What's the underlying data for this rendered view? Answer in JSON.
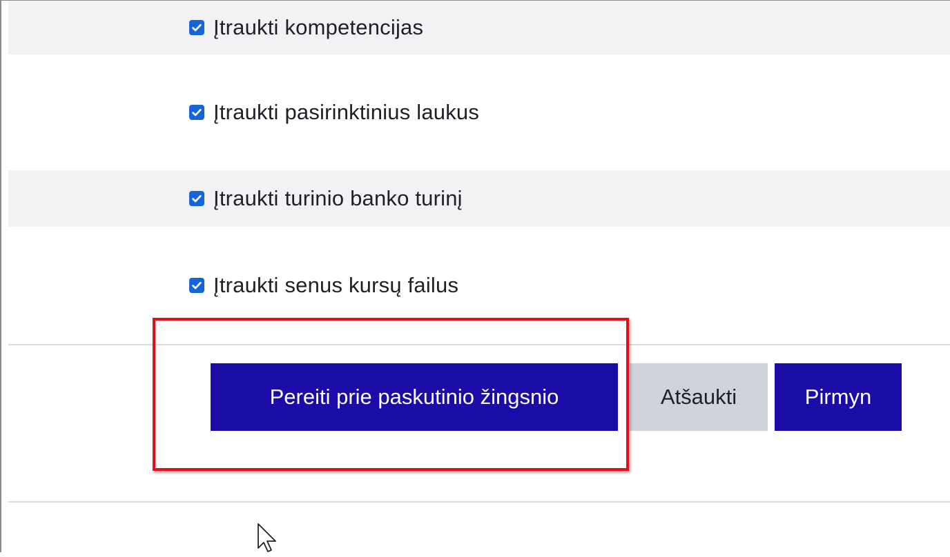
{
  "options": [
    {
      "label": "Įtraukti kompetencijas",
      "checked": true
    },
    {
      "label": "Įtraukti pasirinktinius laukus",
      "checked": true
    },
    {
      "label": "Įtraukti turinio banko turinį",
      "checked": true
    },
    {
      "label": "Įtraukti senus kursų failus",
      "checked": true
    }
  ],
  "buttons": {
    "jump_to_final": "Pereiti prie paskutinio žingsnio",
    "cancel": "Atšaukti",
    "next": "Pirmyn"
  },
  "colors": {
    "primary_button": "#1a0ca6",
    "secondary_button": "#ced4da",
    "checkbox": "#1565d8",
    "highlight": "#e3101a",
    "row_shade": "#f2f2f4"
  },
  "icons": {
    "checkbox_mark": "checkmark-icon",
    "pointer": "mouse-pointer-icon"
  }
}
